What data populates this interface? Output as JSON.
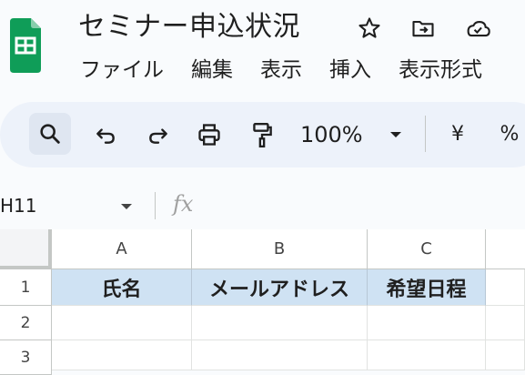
{
  "document": {
    "title": "セミナー申込状況"
  },
  "menu": [
    "ファイル",
    "編集",
    "表示",
    "挿入",
    "表示形式"
  ],
  "toolbar": {
    "zoom": "100%",
    "currency": "¥",
    "percent": "%"
  },
  "formula_bar": {
    "cell_reference": "H11"
  },
  "sheet": {
    "columns": [
      "A",
      "B",
      "C"
    ],
    "rows": [
      "1",
      "2",
      "3"
    ],
    "cells": [
      [
        "氏名",
        "メールアドレス",
        "希望日程"
      ],
      [
        "",
        "",
        ""
      ],
      [
        "",
        "",
        ""
      ]
    ]
  },
  "colors": {
    "header_fill": "#cfe2f3",
    "sheets_green": "#0f9d58",
    "toolbar_bg": "#edf2fa"
  }
}
